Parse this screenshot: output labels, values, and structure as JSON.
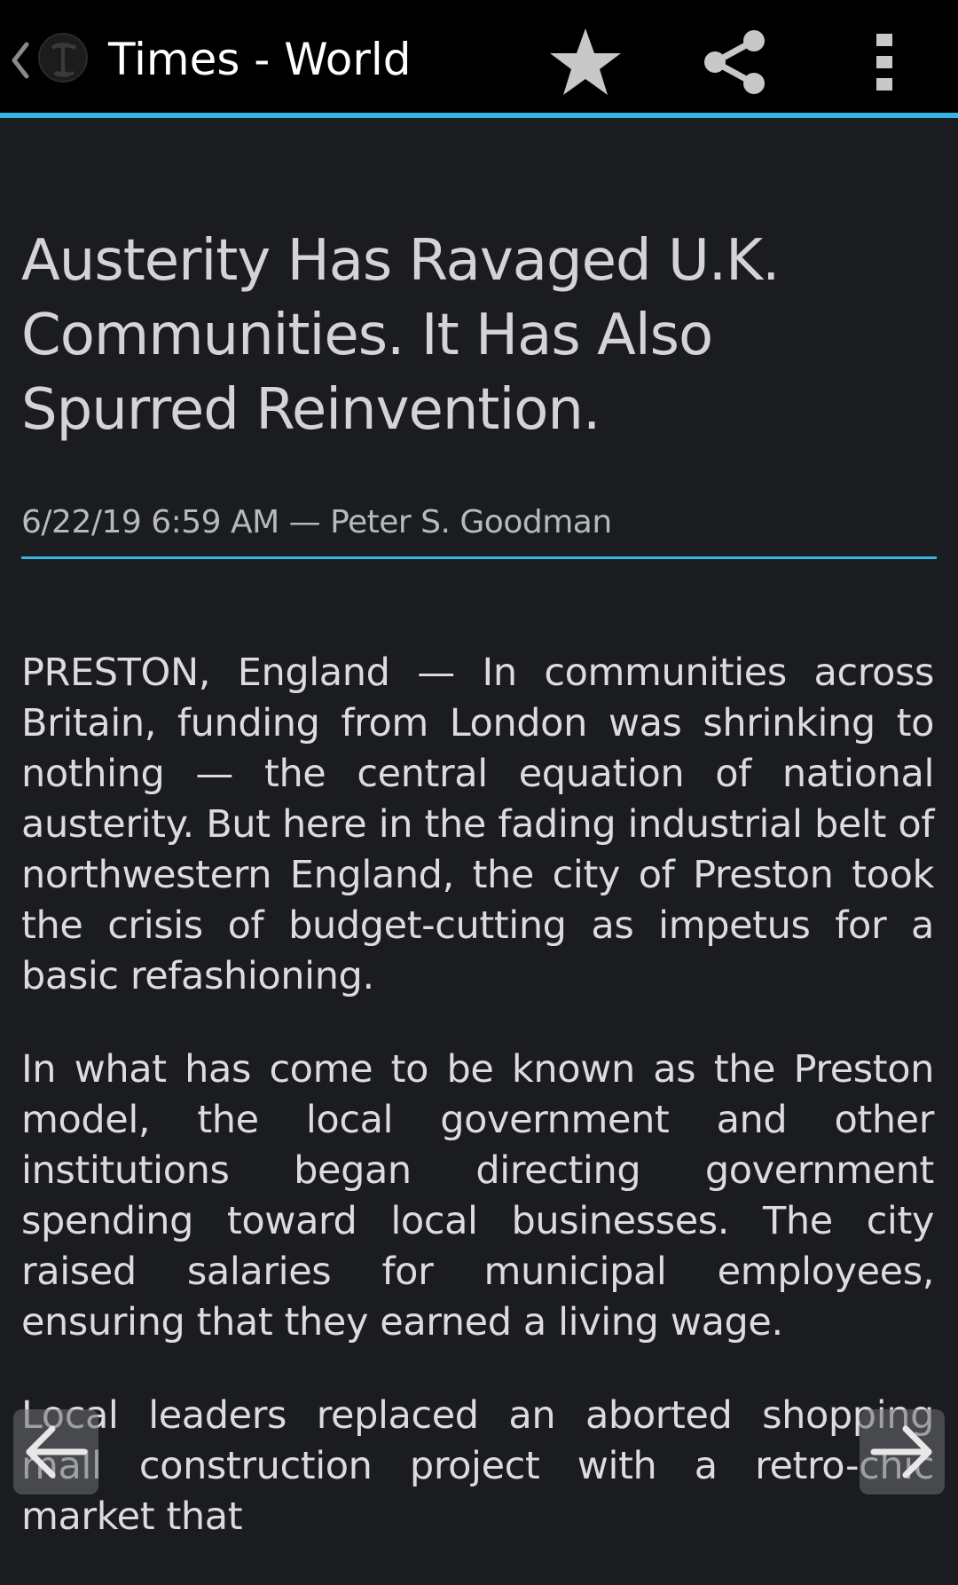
{
  "action_bar": {
    "title": "Times - World",
    "icons": {
      "up": "chevron-left-icon",
      "logo": "nyt-logo",
      "star": "star-icon",
      "share": "share-icon",
      "overflow": "overflow-menu-icon"
    },
    "accent_color": "#33b5e5"
  },
  "article": {
    "headline": "Austerity Has Ravaged U.K. Communities. It Has Also Spurred Reinvention.",
    "byline": "6/22/19 6:59 AM — Peter S. Goodman",
    "paragraphs": [
      "PRESTON, England — In communities across Britain, funding from London was shrinking to nothing — the central equation of national austerity. But here in the fading industrial belt of northwestern England, the city of Preston took the crisis of budget-cutting as impetus for a basic refashioning.",
      "In what has come to be known as the Preston model, the local government and other institutions began directing government spending toward local businesses. The city raised salaries for municipal employees, ensuring that they earned a living wage.",
      "Local leaders replaced an aborted shopping mall construction project with a retro-chic market that"
    ]
  },
  "navigation": {
    "prev_icon": "arrow-left-icon",
    "next_icon": "arrow-right-icon"
  }
}
